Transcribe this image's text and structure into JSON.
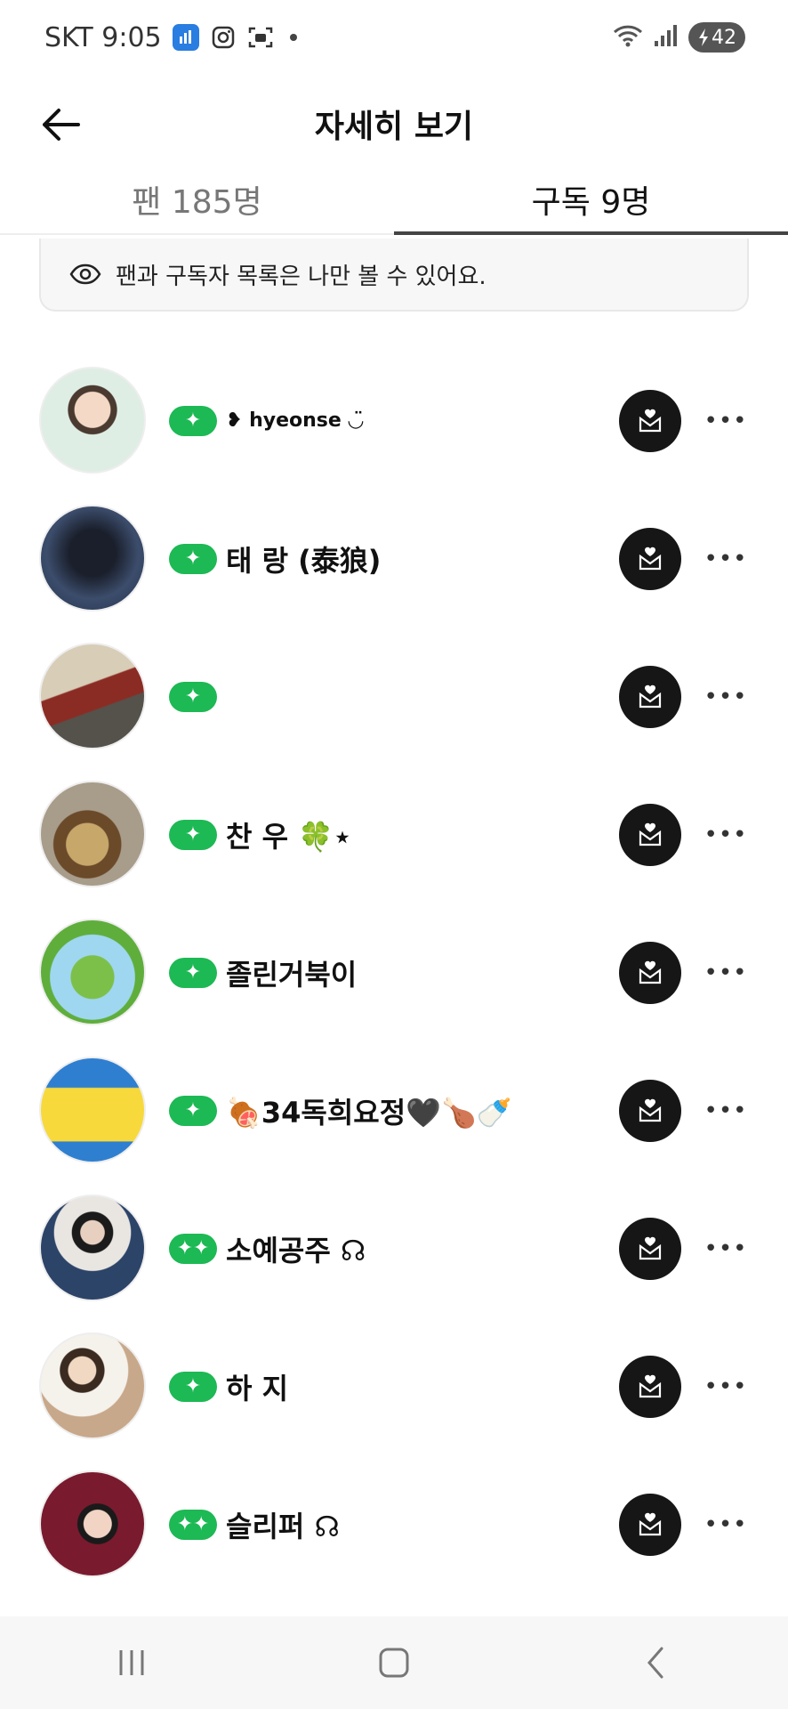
{
  "status_bar": {
    "carrier_time": "SKT 9:05",
    "battery_level": "42",
    "notification_icons": [
      "app-notification-icon",
      "instagram-icon",
      "screenshot-icon"
    ],
    "right_icons": [
      "wifi-icon",
      "signal-icon",
      "battery-icon"
    ]
  },
  "header": {
    "title": "자세히 보기",
    "back_icon": "arrow-left-icon"
  },
  "tabs": [
    {
      "label": "팬 185명",
      "active": false
    },
    {
      "label": "구독 9명",
      "active": true
    }
  ],
  "privacy_notice": {
    "icon": "eye-icon",
    "text": "팬과 구독자 목록은 나만 볼 수 있어요."
  },
  "subscriptions": [
    {
      "name": "❥ hyeonse  ◡̈",
      "badge": "✦",
      "avatar_color": "#dfeee4"
    },
    {
      "name": "태 랑 (泰狼)",
      "badge": "✦",
      "avatar_color": "#2b3a55"
    },
    {
      "name": "",
      "badge": "✦",
      "avatar_color": "#b9a98e"
    },
    {
      "name": "찬 우 🍀⋆",
      "badge": "✦",
      "avatar_color": "#7d6a4a"
    },
    {
      "name": "졸린거북이",
      "badge": "✦",
      "avatar_color": "#7ec3e8"
    },
    {
      "name": "🍖34독희요정🖤🍗🍼",
      "badge": "✦",
      "avatar_color": "#f1d23e"
    },
    {
      "name": "소예공주 ☊",
      "badge": "✦✦",
      "avatar_color": "#2f4466"
    },
    {
      "name": "하 지",
      "badge": "✦",
      "avatar_color": "#d8c1a4"
    },
    {
      "name": "슬리퍼 ☊",
      "badge": "✦✦",
      "avatar_color": "#6a1a2c"
    }
  ],
  "row_actions": {
    "dm_icon": "heart-envelope-icon",
    "more_icon": "more-horizontal-icon",
    "more_label": "•••"
  },
  "nav_bar": {
    "recent_apps_icon": "recent-apps-icon",
    "home_icon": "home-icon",
    "back_icon": "back-chevron-icon"
  },
  "colors": {
    "badge_green": "#1db954",
    "dm_button": "#161616",
    "tab_underline": "#444444"
  }
}
